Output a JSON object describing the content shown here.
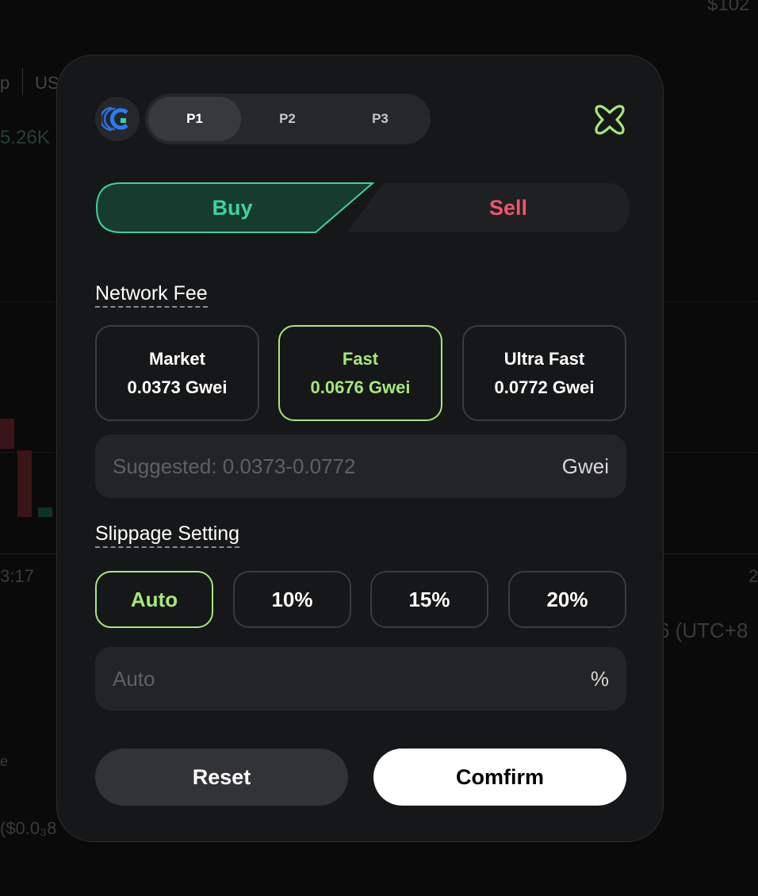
{
  "background": {
    "texts": [
      "$102",
      "p",
      "US",
      "5.26K",
      "3:17",
      "2",
      "6 (UTC+8",
      "e",
      "($0.0₃8"
    ]
  },
  "presets": {
    "tabs": [
      "P1",
      "P2",
      "P3"
    ],
    "active": "P1"
  },
  "side": {
    "buy_label": "Buy",
    "sell_label": "Sell",
    "active": "Buy"
  },
  "network_fee": {
    "title": "Network Fee",
    "options": [
      {
        "name": "Market",
        "value": "0.0373 Gwei"
      },
      {
        "name": "Fast",
        "value": "0.0676 Gwei"
      },
      {
        "name": "Ultra Fast",
        "value": "0.0772 Gwei"
      }
    ],
    "selected": "Fast",
    "input_placeholder": "Suggested: 0.0373-0.0772",
    "input_value": "",
    "unit": "Gwei"
  },
  "slippage": {
    "title": "Slippage Setting",
    "options": [
      "Auto",
      "10%",
      "15%",
      "20%"
    ],
    "selected": "Auto",
    "input_placeholder": "Auto",
    "input_value": "",
    "unit": "%"
  },
  "actions": {
    "reset_label": "Reset",
    "confirm_label": "Comfirm"
  },
  "colors": {
    "buy": "#3fd29b",
    "sell": "#f2546b",
    "accent": "#a6e87a",
    "modal_bg": "#161718"
  }
}
